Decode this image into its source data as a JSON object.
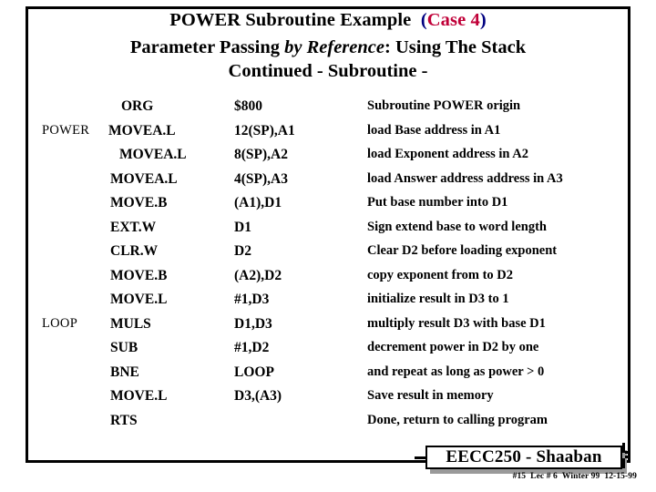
{
  "slide": {
    "title_line1_prefix": "POWER Subroutine Example",
    "title_case_open": "(",
    "title_case_label": "Case 4",
    "title_case_close": ")",
    "title_line2_a": "Parameter Passing ",
    "title_line2_italic": "by Reference",
    "title_line2_b": ": Using The Stack",
    "title_line3": "Continued -  Subroutine -",
    "colors": {
      "paren": "#000080",
      "case_text": "#C00038",
      "frame": "#000000",
      "badge_shadow": "#9a9a9a"
    }
  },
  "code": {
    "columns": [
      "label",
      "mnemonic",
      "operand",
      "comment"
    ],
    "rows": [
      {
        "label": "",
        "mnemonic": "ORG",
        "indent": 133,
        "operand": "$800",
        "comment": "Subroutine  POWER origin"
      },
      {
        "label": "POWER",
        "mnemonic": "MOVEA.L",
        "indent": 119,
        "operand": "12(SP),A1",
        "comment": "load Base address  in A1"
      },
      {
        "label": "",
        "mnemonic": "MOVEA.L",
        "indent": 131,
        "operand": "8(SP),A2",
        "comment": "load Exponent address  in A2"
      },
      {
        "label": "",
        "mnemonic": "MOVEA.L",
        "indent": 121,
        "operand": "4(SP),A3",
        "comment": "load Answer address address in A3"
      },
      {
        "label": "",
        "mnemonic": "MOVE.B",
        "indent": 121,
        "operand": "(A1),D1",
        "comment": "Put base number into D1"
      },
      {
        "label": "",
        "mnemonic": "EXT.W",
        "indent": 121,
        "operand": "D1",
        "comment": "Sign extend base to word length"
      },
      {
        "label": "",
        "mnemonic": "CLR.W",
        "indent": 121,
        "operand": "D2",
        "comment": "Clear D2 before loading exponent"
      },
      {
        "label": "",
        "mnemonic": "MOVE.B",
        "indent": 121,
        "operand": "(A2),D2",
        "comment": "copy exponent from to D2"
      },
      {
        "label": "",
        "mnemonic": "MOVE.L",
        "indent": 121,
        "operand": "#1,D3",
        "comment": "initialize result in D3 to 1"
      },
      {
        "label": "LOOP",
        "mnemonic": "MULS",
        "indent": 121,
        "operand": "D1,D3",
        "comment": "multiply result D3 with base D1"
      },
      {
        "label": "",
        "mnemonic": "SUB",
        "indent": 121,
        "operand": "#1,D2",
        "comment": "decrement power in D2 by one"
      },
      {
        "label": "",
        "mnemonic": "BNE",
        "indent": 121,
        "operand": "LOOP",
        "comment": "and repeat as long as power  > 0"
      },
      {
        "label": "",
        "mnemonic": "MOVE.L",
        "indent": 121,
        "operand": "D3,(A3)",
        "comment": "Save result in memory"
      },
      {
        "label": "",
        "mnemonic": "RTS",
        "indent": 121,
        "operand": "",
        "comment": "Done, return to calling program"
      }
    ]
  },
  "footer": {
    "badge_label": "EECC250 - Shaaban",
    "slide_number": "#15",
    "lecture": "Lec # 6",
    "term": "Winter 99",
    "date": "12-15-99"
  }
}
